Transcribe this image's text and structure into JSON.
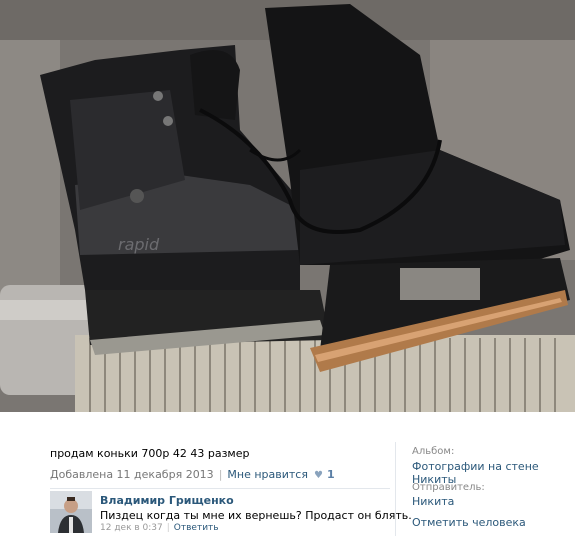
{
  "photo": {
    "description": "продам коньки 700р 42 43 размер",
    "added": "Добавлена 11 декабря 2013",
    "like_label": "Мне нравится",
    "like_count": "1"
  },
  "comment": {
    "author": "Владимир Грищенко",
    "text": "Пиздец когда ты мне их вернешь? Продаст он блять.",
    "time": "12 дек в 0:37",
    "reply": "Ответить"
  },
  "sidebar": {
    "album_label": "Альбом:",
    "album_value": "Фотографии на стене Никиты",
    "sender_label": "Отправитель:",
    "sender_value": "Никита",
    "tag_action": "Отметить человека"
  },
  "image": {
    "skate_brand": "rapid"
  },
  "colors": {
    "link": "#2b587a",
    "meta": "#777777",
    "divider": "#e3e7ec"
  }
}
